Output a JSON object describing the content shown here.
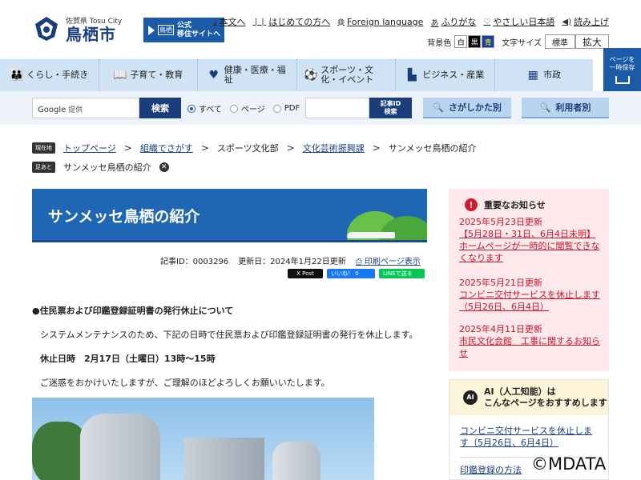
{
  "header": {
    "logo_sub": "佐賀県 Tosu City",
    "logo_main": "鳥栖市",
    "banner_kanji": "鳥栖",
    "banner_line1": "公式",
    "banner_line2": "移住サイトへ",
    "links": [
      {
        "icon": "download-icon",
        "label": "本文へ"
      },
      {
        "icon": "book-icon",
        "label": "はじめての方へ"
      },
      {
        "icon": "globe-icon",
        "label": "Foreign language"
      },
      {
        "icon": "furigana-icon",
        "label": "ふりがな"
      },
      {
        "icon": "heart-icon",
        "label": "やさしい日本語"
      },
      {
        "icon": "speaker-icon",
        "label": "読み上げ"
      }
    ],
    "bg_label": "背景色",
    "bg_white": "白",
    "bg_black": "黒",
    "bg_blue": "青",
    "font_label": "文字サイズ",
    "font_normal": "標準",
    "font_large": "拡大"
  },
  "nav": [
    {
      "icon": "family-icon",
      "label": "くらし・手続き"
    },
    {
      "icon": "book-open-icon",
      "label": "子育て・教育"
    },
    {
      "icon": "heart-icon",
      "label": "健康・医療・福祉"
    },
    {
      "icon": "soccer-icon",
      "label": "スポーツ・文化・イベント"
    },
    {
      "icon": "factory-icon",
      "label": "ビジネス・産業"
    },
    {
      "icon": "city-hall-icon",
      "label": "市政"
    }
  ],
  "side_save": {
    "line1": "ページを",
    "line2": "一時保存"
  },
  "search": {
    "google_label": "Google",
    "google_sub": "提供",
    "button": "検索",
    "radio_all": "すべて",
    "radio_page": "ページ",
    "radio_pdf": "PDF",
    "id_button_line1": "記事ID",
    "id_button_line2": "検索",
    "find_way": "さがしかた別",
    "by_user": "利用者別"
  },
  "breadcrumb": {
    "tag": "現在地",
    "items": [
      "トップページ",
      "組織でさがす",
      "スポーツ文化部",
      "文化芸術振興課",
      "サンメッセ鳥栖の紹介"
    ],
    "footprint_tag": "足あと",
    "footprint_item": "サンメッセ鳥栖の紹介"
  },
  "article": {
    "title": "サンメッセ鳥栖の紹介",
    "id_text": "記事ID：0003296",
    "updated": "更新日：2024年1月22日更新",
    "print": "印刷ページ表示",
    "x_post": "X Post",
    "fb_like": "いいね！ 0",
    "line_send": "LINEで送る",
    "heading": "●住民票および印鑑登録証明書の発行休止について",
    "p1": "システムメンテナンスのため、下記の日時で住民票および印鑑登録証明書の発行を休止します。",
    "p2": "休止日時　2月17日（土曜日）13時～15時",
    "p3": "ご迷惑をおかけいたしますが、ご理解のほどよろしくお願いいたします。"
  },
  "notices": {
    "title": "重要なお知らせ",
    "items": [
      {
        "date": "2025年5月23日更新",
        "text": "【5月28日・31日、6月4日未明】ホームページが一時的に閲覧できなくなります"
      },
      {
        "date": "2025年5月21日更新",
        "text": "コンビニ交付サービスを休止します（5月26日、6月4日）"
      },
      {
        "date": "2025年4月11日更新",
        "text": "市民文化会館　工事に関するお知らせ"
      }
    ]
  },
  "ai": {
    "icon_text": "AI",
    "title_line1": "AI（人工知能）は",
    "title_line2": "こんなページをおすすめします",
    "items": [
      "コンビニ交付サービスを休止します（5月26日、6月4日）",
      "印鑑登録の方法"
    ]
  },
  "watermark": "©MDATA"
}
